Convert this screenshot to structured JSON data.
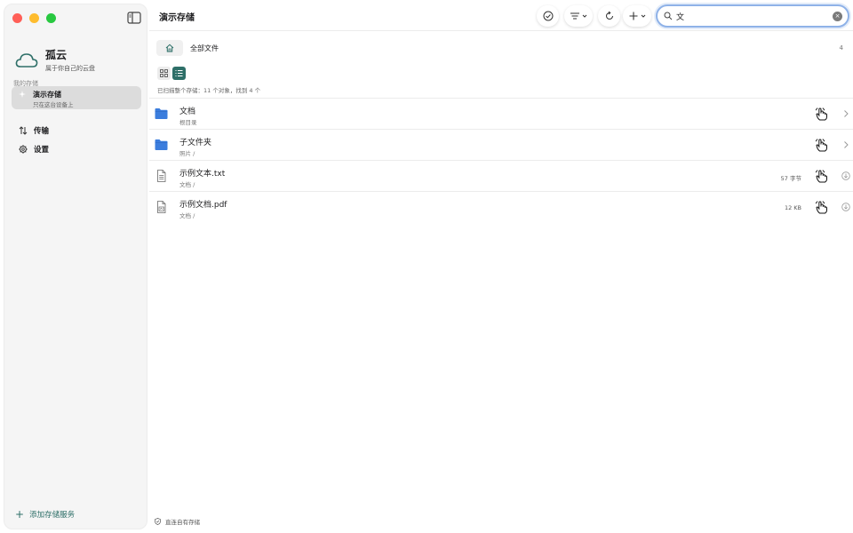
{
  "window": {
    "title": "演示存储"
  },
  "sidebar": {
    "brand_title": "孤云",
    "brand_subtitle": "属于你自己的云盘",
    "section_label": "我的存储",
    "storage": {
      "title": "演示存储",
      "subtitle": "只在这台设备上"
    },
    "nav": [
      {
        "label": "传输",
        "icon": "transfer-icon"
      },
      {
        "label": "设置",
        "icon": "gear-icon"
      }
    ],
    "add_service": "添加存储服务"
  },
  "toolbar": {
    "title": "演示存储",
    "search_value": "文",
    "icons": [
      "check-circle-icon",
      "sort-icon",
      "refresh-icon",
      "plus-icon",
      "search-icon",
      "clear-icon"
    ]
  },
  "breadcrumb": {
    "label": "全部文件",
    "count": "4"
  },
  "scan_info": "已扫描整个存储：11 个对象，找到 4 个",
  "files": [
    {
      "name": "文档",
      "path": "根目录",
      "size": "",
      "type": "folder"
    },
    {
      "name": "子文件夹",
      "path": "照片 /",
      "size": "",
      "type": "folder"
    },
    {
      "name": "示例文本.txt",
      "path": "文档 /",
      "size": "57 字节",
      "type": "text"
    },
    {
      "name": "示例文档.pdf",
      "path": "文档 /",
      "size": "12 KB",
      "type": "pdf"
    }
  ],
  "footer_note": "直连自有存储",
  "colors": {
    "accent": "#2e6f68",
    "folder": "#3b7ddd",
    "search_ring": "#8fb2e8"
  }
}
